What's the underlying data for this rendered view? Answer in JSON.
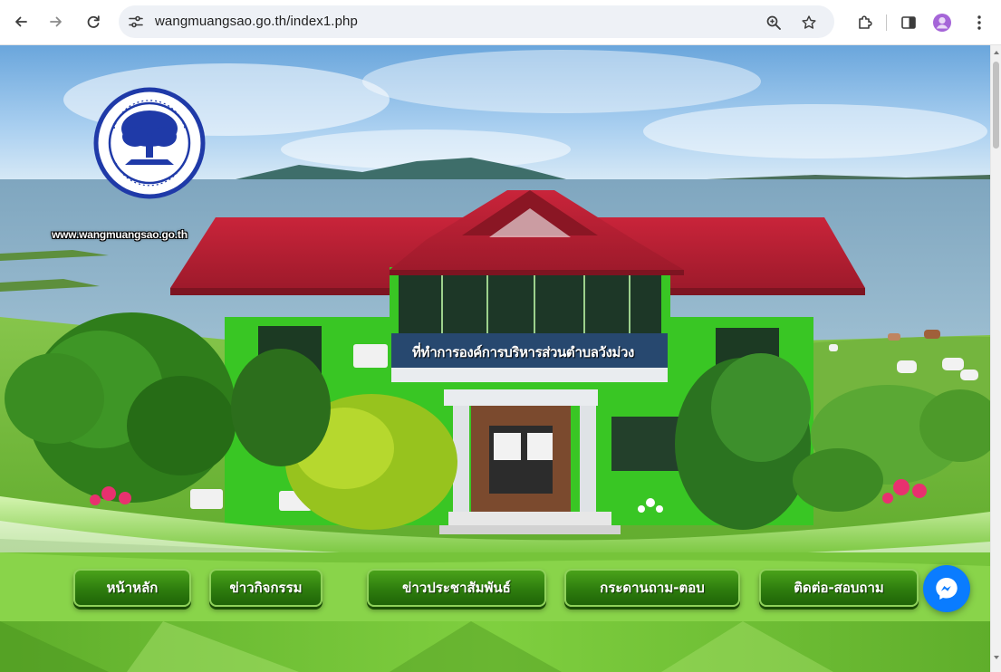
{
  "browser": {
    "url": "wangmuangsao.go.th/index1.php",
    "icons": {
      "back": "arrow-left-icon",
      "forward": "arrow-right-icon",
      "reload": "reload-icon",
      "site_info": "tune-icon",
      "zoom": "zoom-icon",
      "bookmark": "star-icon",
      "extensions": "puzzle-icon",
      "side_panel": "side-panel-icon",
      "profile": "profile-avatar-icon",
      "menu": "kebab-menu-icon"
    },
    "colors": {
      "profile": "#a565d8",
      "omnibox": "#eef1f6"
    }
  },
  "header": {
    "site_url": "www.wangmuangsao.go.th",
    "building_sign": "ที่ทำการองค์การบริหารส่วนตำบลวังม่วง"
  },
  "menu": {
    "items": [
      {
        "label": "หน้าหลัก"
      },
      {
        "label": "ข่าวกิจกรรม"
      },
      {
        "label": "ข่าวประชาสัมพันธ์"
      },
      {
        "label": "กระดานถาม-ตอบ"
      },
      {
        "label": "ติดต่อ-สอบถาม"
      }
    ],
    "colors": {
      "button": "#2e7d0e",
      "border": "#8fd15a"
    }
  },
  "chat": {
    "icon": "messenger-icon",
    "color": "#0a7cff"
  }
}
